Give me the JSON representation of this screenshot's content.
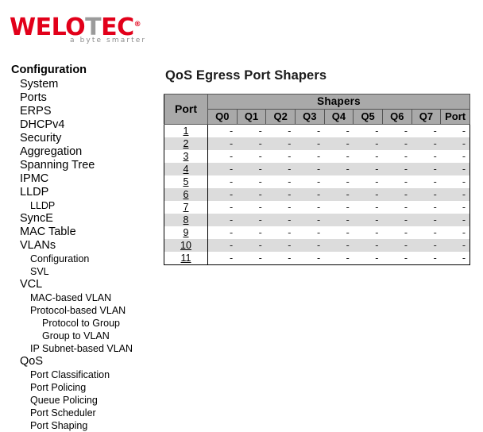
{
  "logo": {
    "wordmark_before": "WELO",
    "wordmark_accent": "T",
    "wordmark_after": "EC",
    "registered_mark": "®",
    "tagline": "a byte smarter",
    "brand_red": "#e2001a",
    "brand_gray": "#9b9b9b"
  },
  "sidebar": {
    "title": "Configuration",
    "items": [
      {
        "label": "System",
        "level": 1
      },
      {
        "label": "Ports",
        "level": 1
      },
      {
        "label": "ERPS",
        "level": 1
      },
      {
        "label": "DHCPv4",
        "level": 1
      },
      {
        "label": "Security",
        "level": 1
      },
      {
        "label": "Aggregation",
        "level": 1
      },
      {
        "label": "Spanning Tree",
        "level": 1
      },
      {
        "label": "IPMC",
        "level": 1
      },
      {
        "label": "LLDP",
        "level": 1
      },
      {
        "label": "LLDP",
        "level": 2
      },
      {
        "label": "SyncE",
        "level": 1
      },
      {
        "label": "MAC Table",
        "level": 1
      },
      {
        "label": "VLANs",
        "level": 1
      },
      {
        "label": "Configuration",
        "level": 2
      },
      {
        "label": "SVL",
        "level": 2
      },
      {
        "label": "VCL",
        "level": 1
      },
      {
        "label": "MAC-based VLAN",
        "level": 2
      },
      {
        "label": "Protocol-based VLAN",
        "level": 2
      },
      {
        "label": "Protocol to Group",
        "level": 3
      },
      {
        "label": "Group to VLAN",
        "level": 3
      },
      {
        "label": "IP Subnet-based VLAN",
        "level": 2
      },
      {
        "label": "QoS",
        "level": 1
      },
      {
        "label": "Port Classification",
        "level": 2
      },
      {
        "label": "Port Policing",
        "level": 2
      },
      {
        "label": "Queue Policing",
        "level": 2
      },
      {
        "label": "Port Scheduler",
        "level": 2
      },
      {
        "label": "Port Shaping",
        "level": 2
      }
    ]
  },
  "main": {
    "page_title": "QoS Egress Port Shapers",
    "table": {
      "port_header": "Port",
      "group_header": "Shapers",
      "queue_headers": [
        "Q0",
        "Q1",
        "Q2",
        "Q3",
        "Q4",
        "Q5",
        "Q6",
        "Q7"
      ],
      "port_shaper_header": "Port",
      "empty_value": "-",
      "rows": [
        {
          "port": "1",
          "values": [
            "-",
            "-",
            "-",
            "-",
            "-",
            "-",
            "-",
            "-",
            "-"
          ]
        },
        {
          "port": "2",
          "values": [
            "-",
            "-",
            "-",
            "-",
            "-",
            "-",
            "-",
            "-",
            "-"
          ]
        },
        {
          "port": "3",
          "values": [
            "-",
            "-",
            "-",
            "-",
            "-",
            "-",
            "-",
            "-",
            "-"
          ]
        },
        {
          "port": "4",
          "values": [
            "-",
            "-",
            "-",
            "-",
            "-",
            "-",
            "-",
            "-",
            "-"
          ]
        },
        {
          "port": "5",
          "values": [
            "-",
            "-",
            "-",
            "-",
            "-",
            "-",
            "-",
            "-",
            "-"
          ]
        },
        {
          "port": "6",
          "values": [
            "-",
            "-",
            "-",
            "-",
            "-",
            "-",
            "-",
            "-",
            "-"
          ]
        },
        {
          "port": "7",
          "values": [
            "-",
            "-",
            "-",
            "-",
            "-",
            "-",
            "-",
            "-",
            "-"
          ]
        },
        {
          "port": "8",
          "values": [
            "-",
            "-",
            "-",
            "-",
            "-",
            "-",
            "-",
            "-",
            "-"
          ]
        },
        {
          "port": "9",
          "values": [
            "-",
            "-",
            "-",
            "-",
            "-",
            "-",
            "-",
            "-",
            "-"
          ]
        },
        {
          "port": "10",
          "values": [
            "-",
            "-",
            "-",
            "-",
            "-",
            "-",
            "-",
            "-",
            "-"
          ]
        },
        {
          "port": "11",
          "values": [
            "-",
            "-",
            "-",
            "-",
            "-",
            "-",
            "-",
            "-",
            "-"
          ]
        }
      ]
    }
  }
}
